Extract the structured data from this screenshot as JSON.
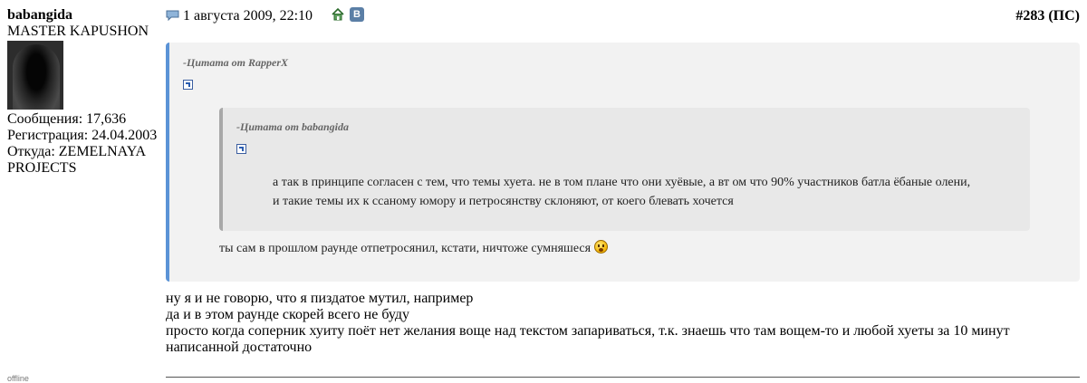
{
  "user": {
    "name": "babangida",
    "title": "MASTER KAPUSHON",
    "posts": "Сообщения: 17,636",
    "registered": "Регистрация: 24.04.2003",
    "location_line1": "Откуда: ZEMELNAYA",
    "location_line2": "PROJECTS",
    "status": "offline"
  },
  "post": {
    "date": "1 августа 2009, 22:10",
    "number_prefix": "#283 (",
    "number_link": "ПС",
    "number_suffix": ")",
    "vk_label": "B",
    "icons": [
      "post-icon",
      "home-icon",
      "vk-icon"
    ]
  },
  "quote_outer": {
    "title": "-Цитата от RapperX",
    "reply": "ты сам в прошлом раунде отпетросянил, кстати, ничтоже сумняшеся"
  },
  "quote_inner": {
    "title": "-Цитата от babangida",
    "lines": [
      "а так в принципе согласен с тем, что темы хуета. не в том плане что они хуёвые, а вт ом что 90% участников батла ёбаные олени,",
      "и такие темы их к ссаному юмору и петросянству склоняют, от коего блевать хочется"
    ]
  },
  "body": {
    "lines": [
      "ну я и не говорю, что я пиздатое мутил, например",
      "да и в этом раунде скорей всего не буду",
      "просто когда соперник хуиту поёт нет желания воще над текстом запариваться, т.к. знаешь что там вощем-то и любой хуеты за 10 минут",
      "написанной достаточно"
    ]
  },
  "colors": {
    "outer_quote_border": "#5b93d6",
    "outer_quote_bg": "#f2f2f2",
    "inner_quote_border": "#a8a8a8",
    "inner_quote_bg": "#e8e8e8",
    "vk_badge": "#5b7fa6"
  }
}
